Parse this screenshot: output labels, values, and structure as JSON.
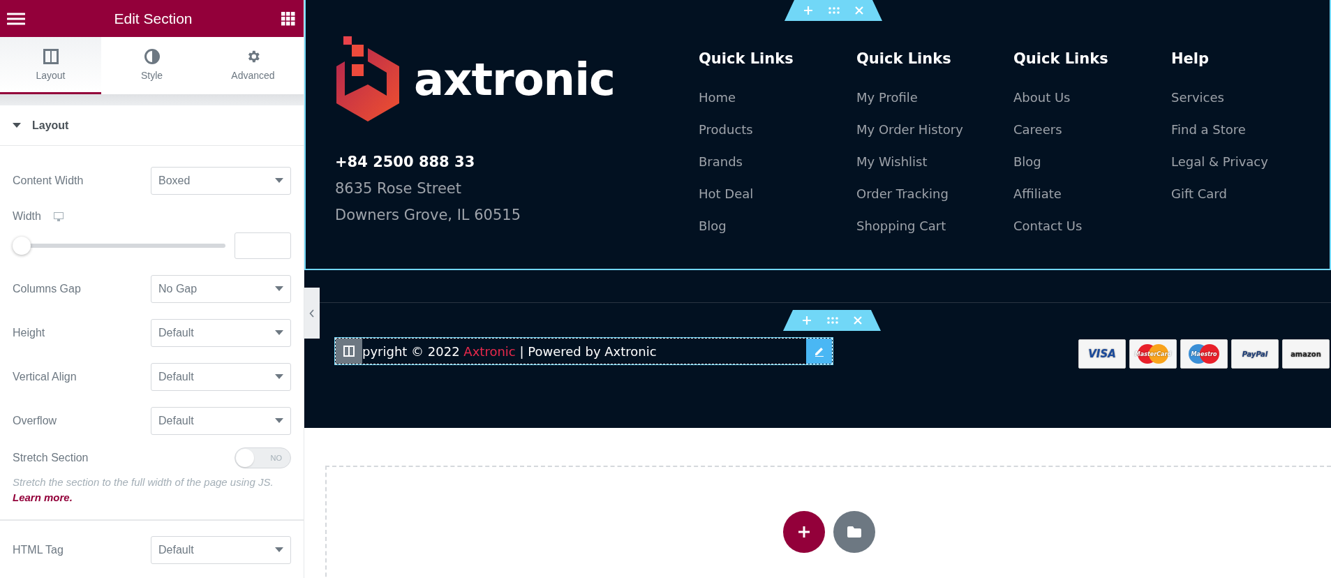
{
  "panel": {
    "title": "Edit Section",
    "tabs": [
      {
        "label": "Layout",
        "selected": true
      },
      {
        "label": "Style",
        "selected": false
      },
      {
        "label": "Advanced",
        "selected": false
      }
    ],
    "section": {
      "title": "Layout",
      "expanded": true
    },
    "controls": [
      {
        "kind": "select",
        "label": "Content Width",
        "value": "Boxed"
      },
      {
        "kind": "slider",
        "label": "Width",
        "level": 0
      },
      {
        "kind": "select",
        "label": "Columns Gap",
        "value": "No Gap"
      },
      {
        "kind": "select",
        "label": "Height",
        "value": "Default"
      },
      {
        "kind": "select",
        "label": "Vertical Align",
        "value": "Default"
      },
      {
        "kind": "select",
        "label": "Overflow",
        "value": "Default"
      },
      {
        "kind": "switch",
        "label": "Stretch Section",
        "on": false,
        "state_label": "NO",
        "help": "Stretch the section to the full width of the page using JS.",
        "help_link": "Learn more."
      }
    ],
    "more_controls": [
      {
        "kind": "select",
        "label": "HTML Tag",
        "value": "Default"
      }
    ]
  },
  "footer": {
    "logo": "axtronic",
    "phone": "+84 2500 888 33",
    "address": [
      "8635 Rose Street",
      "Downers Grove, IL 60515"
    ],
    "columns": [
      {
        "title": "Quick Links",
        "links": [
          "Home",
          "Products",
          "Brands",
          "Hot Deal",
          "Blog"
        ]
      },
      {
        "title": "Quick Links",
        "links": [
          "My Profile",
          "My Order History",
          "My Wishlist",
          "Order Tracking",
          "Shopping Cart"
        ]
      },
      {
        "title": "Quick Links",
        "links": [
          "About Us",
          "Careers",
          "Blog",
          "Affiliate",
          "Contact Us"
        ]
      },
      {
        "title": "Help",
        "links": [
          "Services",
          "Find a Store",
          "Legal & Privacy",
          "Gift Card"
        ]
      }
    ],
    "copyright": {
      "before": "pyright © 2022 ",
      "brand": "Axtronic",
      "after": " | Powered by Axtronic"
    },
    "payments": [
      {
        "kind": "visa",
        "label": "VISA"
      },
      {
        "kind": "mastercard",
        "label": "MasterCard"
      },
      {
        "kind": "maestro",
        "label": "Maestro"
      },
      {
        "kind": "paypal",
        "label": "PayPal"
      },
      {
        "kind": "amazon",
        "label": "amazon"
      }
    ]
  }
}
